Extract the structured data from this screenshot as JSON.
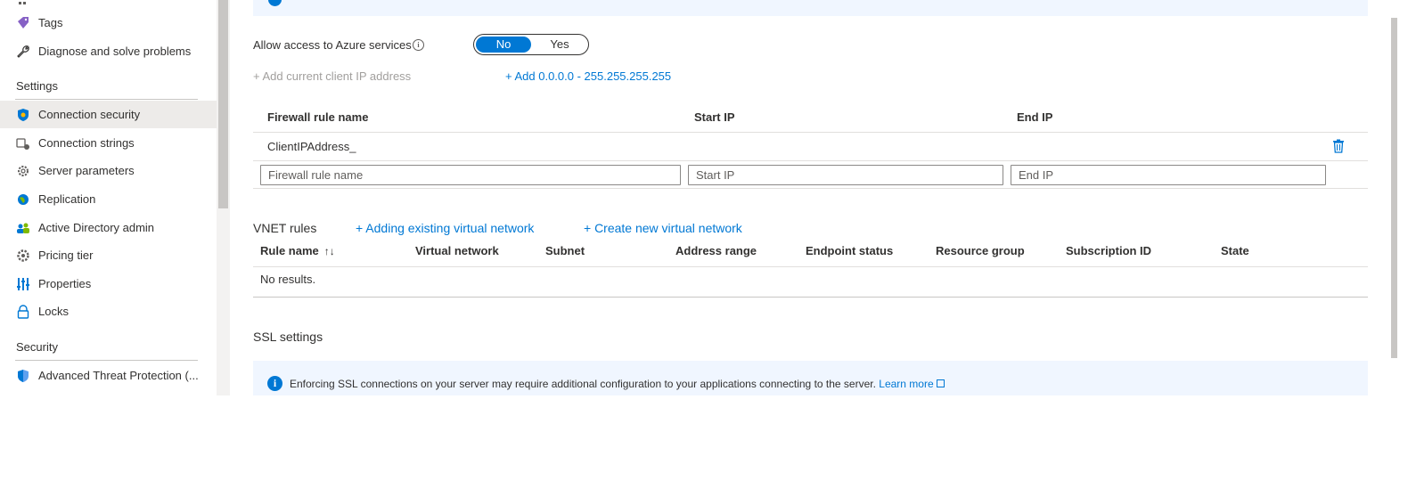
{
  "sidebar": {
    "items": [
      {
        "label": "Tags",
        "icon": "tag-icon"
      },
      {
        "label": "Diagnose and solve problems",
        "icon": "wrench-icon"
      }
    ],
    "settings_heading": "Settings",
    "settings_items": [
      {
        "label": "Connection security",
        "icon": "shield-icon",
        "active": true
      },
      {
        "label": "Connection strings",
        "icon": "plug-icon"
      },
      {
        "label": "Server parameters",
        "icon": "gear-icon"
      },
      {
        "label": "Replication",
        "icon": "globe-icon"
      },
      {
        "label": "Active Directory admin",
        "icon": "users-icon"
      },
      {
        "label": "Pricing tier",
        "icon": "gear-icon"
      },
      {
        "label": "Properties",
        "icon": "sliders-icon"
      },
      {
        "label": "Locks",
        "icon": "lock-icon"
      }
    ],
    "security_heading": "Security",
    "security_items": [
      {
        "label": "Advanced Threat Protection (...",
        "icon": "shield-icon"
      }
    ]
  },
  "access": {
    "label": "Allow access to Azure services",
    "toggle_no": "No",
    "toggle_yes": "Yes",
    "selected": "No"
  },
  "links": {
    "add_client_ip": "+ Add current client IP address",
    "add_range": "+ Add 0.0.0.0 - 255.255.255.255"
  },
  "firewall": {
    "headers": {
      "name": "Firewall rule name",
      "start": "Start IP",
      "end": "End IP"
    },
    "rows": [
      {
        "name": "ClientIPAddress_",
        "start": "",
        "end": ""
      }
    ],
    "placeholders": {
      "name": "Firewall rule name",
      "start": "Start IP",
      "end": "End IP"
    }
  },
  "vnet": {
    "title": "VNET rules",
    "add_existing": "+ Adding existing virtual network",
    "create_new": "+ Create new virtual network",
    "headers": [
      "Rule name",
      "Virtual network",
      "Subnet",
      "Address range",
      "Endpoint status",
      "Resource group",
      "Subscription ID",
      "State"
    ],
    "empty_text": "No results."
  },
  "ssl": {
    "title": "SSL settings",
    "info_text": "Enforcing SSL connections on your server may require additional configuration to your applications connecting to the server.",
    "learn_more": "Learn more"
  },
  "colors": {
    "accent": "#0078d4",
    "info_bg": "#f0f6ff",
    "active_bg": "#edebe9"
  }
}
